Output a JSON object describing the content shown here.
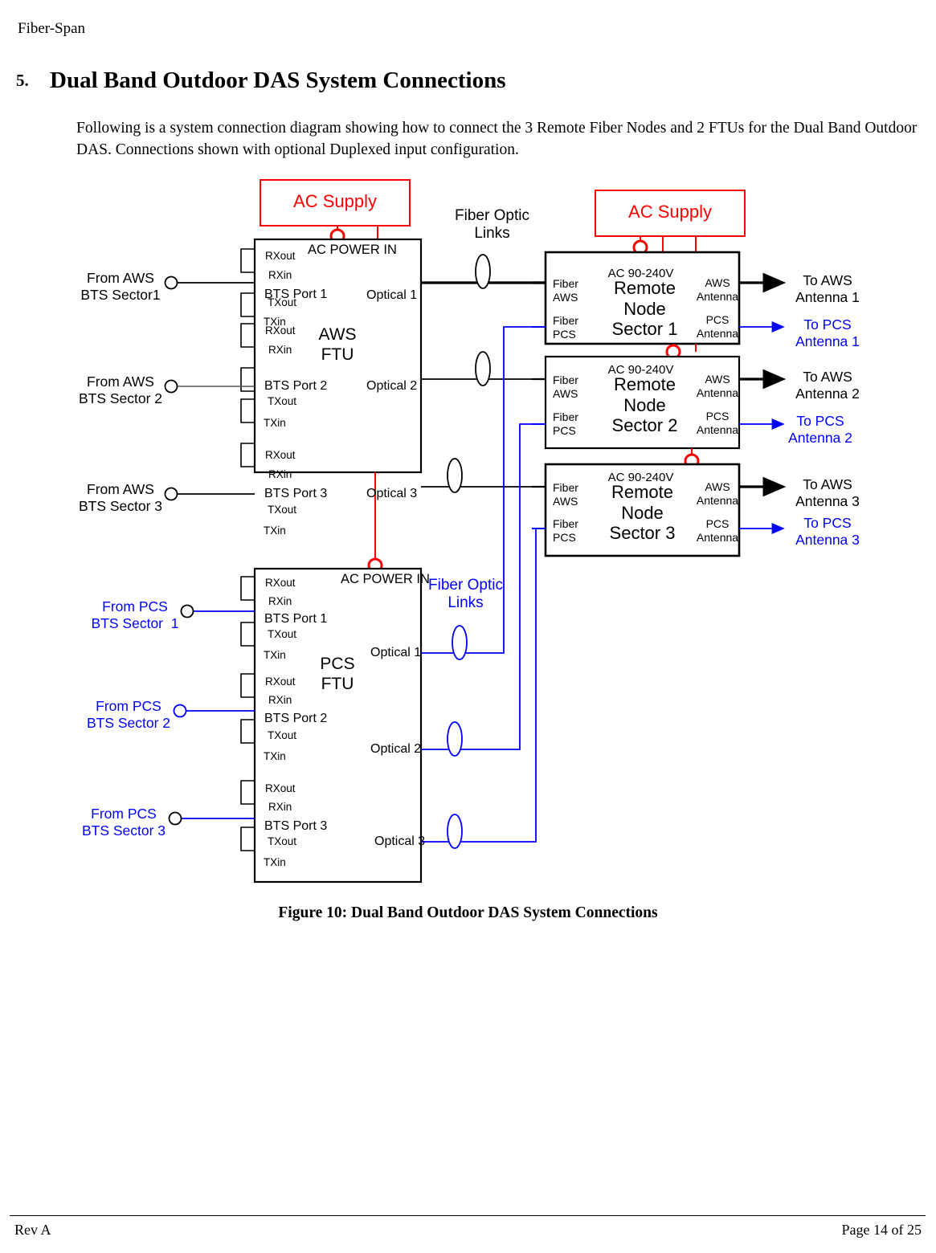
{
  "document": {
    "header_label": "Fiber-Span",
    "section_number": "5.",
    "section_title": "Dual Band Outdoor DAS System Connections",
    "paragraph": "Following is a system connection diagram showing how to connect the 3 Remote Fiber Nodes and 2 FTUs for the Dual Band Outdoor DAS.  Connections shown with optional Duplexed input configuration.",
    "figure_caption": "Figure 10: Dual Band Outdoor DAS System Connections",
    "footer_left": "Rev A",
    "footer_right": "Page 14 of 25"
  },
  "colors": {
    "red": "#ff0000",
    "blue": "#0000ff",
    "black": "#000000"
  },
  "diagram": {
    "ac_supply_left": {
      "label": "AC Supply"
    },
    "ac_supply_right": {
      "label": "AC Supply"
    },
    "fiber_links_top_label": "Fiber Optic\nLinks",
    "fiber_links_bottom_label": "Fiber Optic\nLinks",
    "aws_ftu": {
      "title": "AWS\nFTU",
      "ac_power_in": "AC POWER IN",
      "ports": [
        {
          "rxout": "RXout",
          "rxin": "RXin",
          "name": "BTS Port 1",
          "txout": "TXout",
          "txin": "TXin",
          "optical": "Optical 1"
        },
        {
          "rxout": "RXout",
          "rxin": "RXin",
          "name": "BTS Port 2",
          "txout": "TXout",
          "txin": "TXin",
          "optical": "Optical 2"
        },
        {
          "rxout": "RXout",
          "rxin": "RXin",
          "name": "BTS Port 3",
          "txout": "TXout",
          "txin": "TXin",
          "optical": "Optical 3"
        }
      ],
      "inputs": [
        "From AWS\nBTS Sector1",
        "From AWS\nBTS Sector 2",
        "From AWS\nBTS Sector 3"
      ]
    },
    "pcs_ftu": {
      "title": "PCS\nFTU",
      "ac_power_in": "AC POWER IN",
      "ports": [
        {
          "rxout": "RXout",
          "rxin": "RXin",
          "name": "BTS Port 1",
          "txout": "TXout",
          "txin": "TXin",
          "optical": "Optical 1"
        },
        {
          "rxout": "RXout",
          "rxin": "RXin",
          "name": "BTS Port 2",
          "txout": "TXout",
          "txin": "TXin",
          "optical": "Optical 2"
        },
        {
          "rxout": "RXout",
          "rxin": "RXin",
          "name": "BTS Port 3",
          "txout": "TXout",
          "txin": "TXin",
          "optical": "Optical 3"
        }
      ],
      "inputs": [
        "From PCS\nBTS Sector  1",
        "From PCS\nBTS Sector 2",
        "From PCS\nBTS Sector 3"
      ]
    },
    "remote_nodes": [
      {
        "voltage": "AC 90-240V",
        "title": "Remote\nNode\nSector 1",
        "in_aws": "Fiber\nAWS",
        "in_pcs": "Fiber\nPCS",
        "out_aws": "AWS\nAntenna",
        "out_pcs": "PCS\nAntenna",
        "to_aws": "To AWS\nAntenna 1",
        "to_pcs": "To PCS\nAntenna 1"
      },
      {
        "voltage": "AC 90-240V",
        "title": "Remote\nNode\nSector 2",
        "in_aws": "Fiber\nAWS",
        "in_pcs": "Fiber\nPCS",
        "out_aws": "AWS\nAntenna",
        "out_pcs": "PCS\nAntenna",
        "to_aws": "To AWS\nAntenna 2",
        "to_pcs": "To PCS\nAntenna 2"
      },
      {
        "voltage": "AC 90-240V",
        "title": "Remote\nNode\nSector 3",
        "in_aws": "Fiber\nAWS",
        "in_pcs": "Fiber\nPCS",
        "out_aws": "AWS\nAntenna",
        "out_pcs": "PCS\nAntenna",
        "to_aws": "To AWS\nAntenna 3",
        "to_pcs": "To PCS\nAntenna 3"
      }
    ]
  }
}
